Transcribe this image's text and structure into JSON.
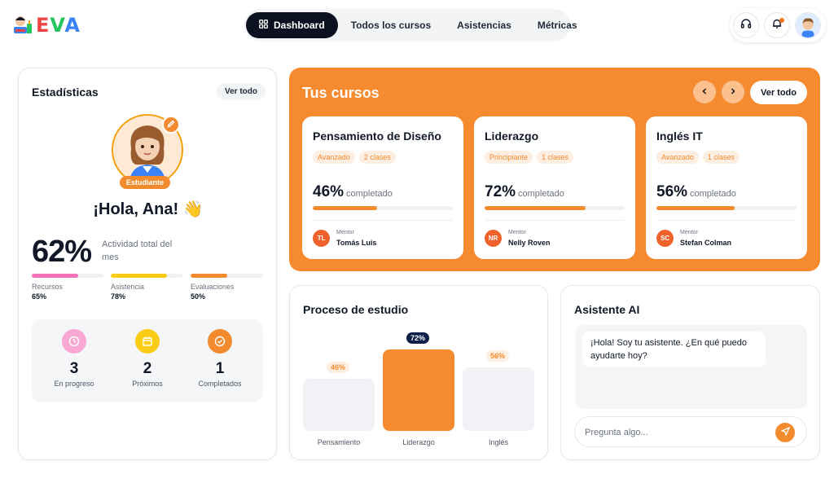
{
  "app": {
    "logo_text": "EVA",
    "nav": [
      {
        "label": "Dashboard",
        "icon": "grid-icon",
        "active": true
      },
      {
        "label": "Todos los cursos"
      },
      {
        "label": "Asistencias"
      },
      {
        "label": "Métricas"
      }
    ],
    "actions": [
      "headset-icon",
      "bell-icon",
      "user-avatar"
    ]
  },
  "stats": {
    "title": "Estadísticas",
    "view_all": "Ver todo",
    "role_tag": "Estudiante",
    "greeting": "¡Hola, Ana! 👋",
    "activity_pct": "62%",
    "activity_label": "Actividad total del mes",
    "metrics": [
      {
        "label": "Recursos",
        "value": "65%",
        "fraction": 0.65,
        "color": "#f472b6"
      },
      {
        "label": "Asistencia",
        "value": "78%",
        "fraction": 0.78,
        "color": "#facc15"
      },
      {
        "label": "Evaluaciones",
        "value": "50%",
        "fraction": 0.5,
        "color": "#f28b2e"
      }
    ],
    "summary": [
      {
        "count": "3",
        "label": "En progreso",
        "icon": "clock-icon",
        "color": "#f9a8d4"
      },
      {
        "count": "2",
        "label": "Próximos",
        "icon": "calendar-icon",
        "color": "#facc15"
      },
      {
        "count": "1",
        "label": "Completados",
        "icon": "check-circle-icon",
        "color": "#f28b2e"
      }
    ]
  },
  "courses": {
    "title": "Tus cursos",
    "view_all": "Ver todo",
    "completed_word": "completado",
    "mentor_word": "Mentor",
    "items": [
      {
        "title": "Pensamiento de Diseño",
        "level": "Avanzado",
        "classes": "2 clases",
        "pct": "46%",
        "fraction": 0.46,
        "mentor": "Tomás Luis",
        "initials": "TL"
      },
      {
        "title": "Liderazgo",
        "level": "Principiante",
        "classes": "1 clases",
        "pct": "72%",
        "fraction": 0.72,
        "mentor": "Nelly Roven",
        "initials": "NR"
      },
      {
        "title": "Inglés IT",
        "level": "Avanzado",
        "classes": "1 clases",
        "pct": "56%",
        "fraction": 0.56,
        "mentor": "Stefan Colman",
        "initials": "SC"
      }
    ]
  },
  "process": {
    "title": "Proceso de estudio",
    "chart_data": {
      "type": "bar",
      "categories": [
        "Pensamiento",
        "Liderazgo",
        "Inglés"
      ],
      "values": [
        46,
        72,
        56
      ],
      "value_labels": [
        "46%",
        "72%",
        "56%"
      ],
      "highlight_index": 1
    }
  },
  "assistant": {
    "title": "Asistente AI",
    "message": "¡Hola! Soy tu asistente. ¿En qué puedo ayudarte hoy?",
    "placeholder": "Pregunta algo..."
  }
}
